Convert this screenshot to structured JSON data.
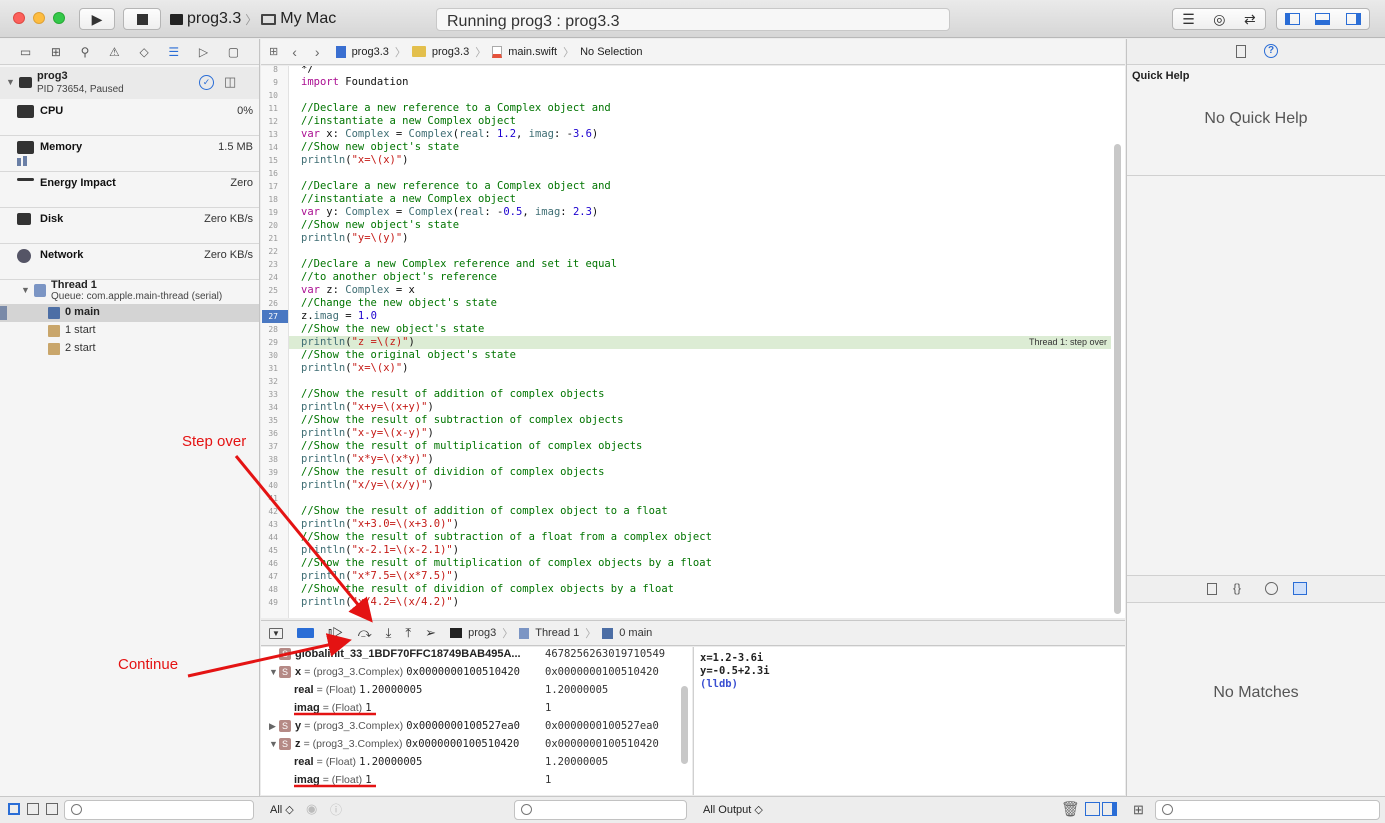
{
  "toolbar": {
    "scheme_target": "prog3.3",
    "scheme_device": "My Mac",
    "status_text": "Running prog3 : prog3.3"
  },
  "navigator": {
    "process_name": "prog3",
    "process_status": "PID 73654, Paused",
    "gauges": [
      {
        "name": "CPU",
        "value": "0%"
      },
      {
        "name": "Memory",
        "value": "1.5 MB"
      },
      {
        "name": "Energy Impact",
        "value": "Zero"
      },
      {
        "name": "Disk",
        "value": "Zero KB/s"
      },
      {
        "name": "Network",
        "value": "Zero KB/s"
      }
    ],
    "thread_name": "Thread 1",
    "thread_queue": "Queue: com.apple.main-thread (serial)",
    "frames": [
      "0 main",
      "1 start",
      "2 start"
    ]
  },
  "jumpbar": {
    "project": "prog3.3",
    "group": "prog3.3",
    "file": "main.swift",
    "selection": "No Selection"
  },
  "editor": {
    "current_line": 29,
    "step_label": "Thread 1: step over",
    "lines": [
      {
        "n": "8",
        "t": "*/"
      },
      {
        "n": "9",
        "t": "import Foundation"
      },
      {
        "n": "10",
        "t": ""
      },
      {
        "n": "11",
        "t": "//Declare a new reference to a Complex object and"
      },
      {
        "n": "12",
        "t": "//instantiate a new Complex object"
      },
      {
        "n": "13",
        "t": "var x: Complex = Complex(real: 1.2, imag: -3.6)"
      },
      {
        "n": "14",
        "t": "//Show new object's state"
      },
      {
        "n": "15",
        "t": "println(\"x=\\(x)\")"
      },
      {
        "n": "16",
        "t": ""
      },
      {
        "n": "17",
        "t": "//Declare a new reference to a Complex object and"
      },
      {
        "n": "18",
        "t": "//instantiate a new Complex object"
      },
      {
        "n": "19",
        "t": "var y: Complex = Complex(real: -0.5, imag: 2.3)"
      },
      {
        "n": "20",
        "t": "//Show new object's state"
      },
      {
        "n": "21",
        "t": "println(\"y=\\(y)\")"
      },
      {
        "n": "22",
        "t": ""
      },
      {
        "n": "23",
        "t": "//Declare a new Complex reference and set it equal"
      },
      {
        "n": "24",
        "t": "//to another object's reference"
      },
      {
        "n": "25",
        "t": "var z: Complex = x"
      },
      {
        "n": "26",
        "t": "//Change the new object's state"
      },
      {
        "n": "27",
        "t": "z.imag = 1.0"
      },
      {
        "n": "28",
        "t": "//Show the new object's state"
      },
      {
        "n": "29",
        "t": "println(\"z =\\(z)\")"
      },
      {
        "n": "30",
        "t": "//Show the original object's state"
      },
      {
        "n": "31",
        "t": "println(\"x=\\(x)\")"
      },
      {
        "n": "32",
        "t": ""
      },
      {
        "n": "33",
        "t": "//Show the result of addition of complex objects"
      },
      {
        "n": "34",
        "t": "println(\"x+y=\\(x+y)\")"
      },
      {
        "n": "35",
        "t": "//Show the result of subtraction of complex objects"
      },
      {
        "n": "36",
        "t": "println(\"x-y=\\(x-y)\")"
      },
      {
        "n": "37",
        "t": "//Show the result of multiplication of complex objects"
      },
      {
        "n": "38",
        "t": "println(\"x*y=\\(x*y)\")"
      },
      {
        "n": "39",
        "t": "//Show the result of dividion of complex objects"
      },
      {
        "n": "40",
        "t": "println(\"x/y=\\(x/y)\")"
      },
      {
        "n": "41",
        "t": ""
      },
      {
        "n": "42",
        "t": "//Show the result of addition of complex object to a float"
      },
      {
        "n": "43",
        "t": "println(\"x+3.0=\\(x+3.0)\")"
      },
      {
        "n": "44",
        "t": "//Show the result of subtraction of a float from a complex object"
      },
      {
        "n": "45",
        "t": "println(\"x-2.1=\\(x-2.1)\")"
      },
      {
        "n": "46",
        "t": "//Show the result of multiplication of complex objects by a float"
      },
      {
        "n": "47",
        "t": "println(\"x*7.5=\\(x*7.5)\")"
      },
      {
        "n": "48",
        "t": "//Show the result of dividion of complex objects by a float"
      },
      {
        "n": "49",
        "t": "println(\"x/4.2=\\(x/4.2)\")"
      }
    ]
  },
  "debugbar": {
    "process": "prog3",
    "thread": "Thread 1",
    "frame": "0 main"
  },
  "variables": [
    {
      "indent": 0,
      "tri": "",
      "badge": "S",
      "name": "globalinit_33_1BDF70FFC18749BAB495A...",
      "type": "",
      "val": "",
      "summary": "4678256263019710549"
    },
    {
      "indent": 0,
      "tri": "▼",
      "badge": "S",
      "name": "x",
      "type": "= (prog3_3.Complex)",
      "val": "0x0000000100510420",
      "summary": "0x0000000100510420"
    },
    {
      "indent": 1,
      "tri": "",
      "badge": "",
      "name": "real",
      "type": "= (Float)",
      "val": "1.20000005",
      "summary": "1.20000005"
    },
    {
      "indent": 1,
      "tri": "",
      "badge": "",
      "name": "imag",
      "type": "= (Float)",
      "val": "1",
      "summary": "1"
    },
    {
      "indent": 0,
      "tri": "▶",
      "badge": "S",
      "name": "y",
      "type": "= (prog3_3.Complex)",
      "val": "0x0000000100527ea0",
      "summary": "0x0000000100527ea0"
    },
    {
      "indent": 0,
      "tri": "▼",
      "badge": "S",
      "name": "z",
      "type": "= (prog3_3.Complex)",
      "val": "0x0000000100510420",
      "summary": "0x0000000100510420"
    },
    {
      "indent": 1,
      "tri": "",
      "badge": "",
      "name": "real",
      "type": "= (Float)",
      "val": "1.20000005",
      "summary": "1.20000005"
    },
    {
      "indent": 1,
      "tri": "",
      "badge": "",
      "name": "imag",
      "type": "= (Float)",
      "val": "1",
      "summary": "1"
    }
  ],
  "console": {
    "lines": [
      "x=1.2-3.6i",
      "y=-0.5+2.3i"
    ],
    "prompt": "(lldb)"
  },
  "bottom": {
    "vars_scope": "All ◇",
    "output_scope": "All Output ◇"
  },
  "inspector": {
    "title": "Quick Help",
    "no_help": "No Quick Help",
    "no_matches": "No Matches"
  },
  "annotations": {
    "step_over": "Step over",
    "continue": "Continue"
  },
  "colors": {
    "accent": "#2a6dd6",
    "annotation": "#e41313",
    "current_line": "#dcecd4"
  }
}
